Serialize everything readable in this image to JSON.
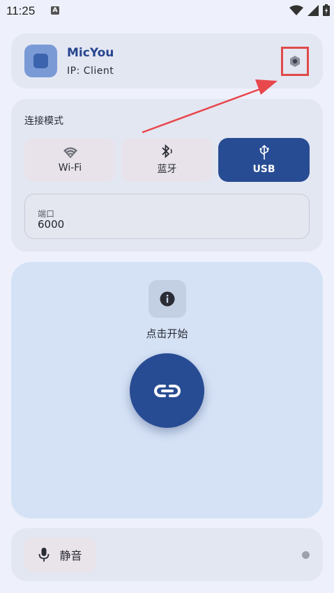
{
  "status_bar": {
    "time": "11:25",
    "notification_badge": "A",
    "icons": [
      "wifi-icon",
      "signal-icon",
      "battery-icon"
    ]
  },
  "header": {
    "app_name": "MicYou",
    "ip_text": "IP:  Client",
    "settings_icon": "hexagon-settings-icon",
    "highlight_color": "#e04a4a"
  },
  "connection": {
    "section_label": "连接模式",
    "modes": [
      {
        "label": "Wi-Fi",
        "icon": "wifi-icon",
        "selected": false
      },
      {
        "label": "蓝牙",
        "icon": "bluetooth-icon",
        "selected": false
      },
      {
        "label": "USB",
        "icon": "usb-icon",
        "selected": true
      }
    ],
    "port": {
      "label": "端口",
      "value": "6000"
    }
  },
  "main": {
    "start_text": "点击开始",
    "info_icon": "info-icon",
    "connect_icon": "link-icon"
  },
  "bottom": {
    "mute_label": "静音",
    "mute_icon": "microphone-icon"
  },
  "colors": {
    "accent": "#284c93",
    "background": "#eef1fb",
    "card": "#e3e7f2",
    "main_card": "#d5e2f6",
    "arrow": "#e8474c"
  }
}
